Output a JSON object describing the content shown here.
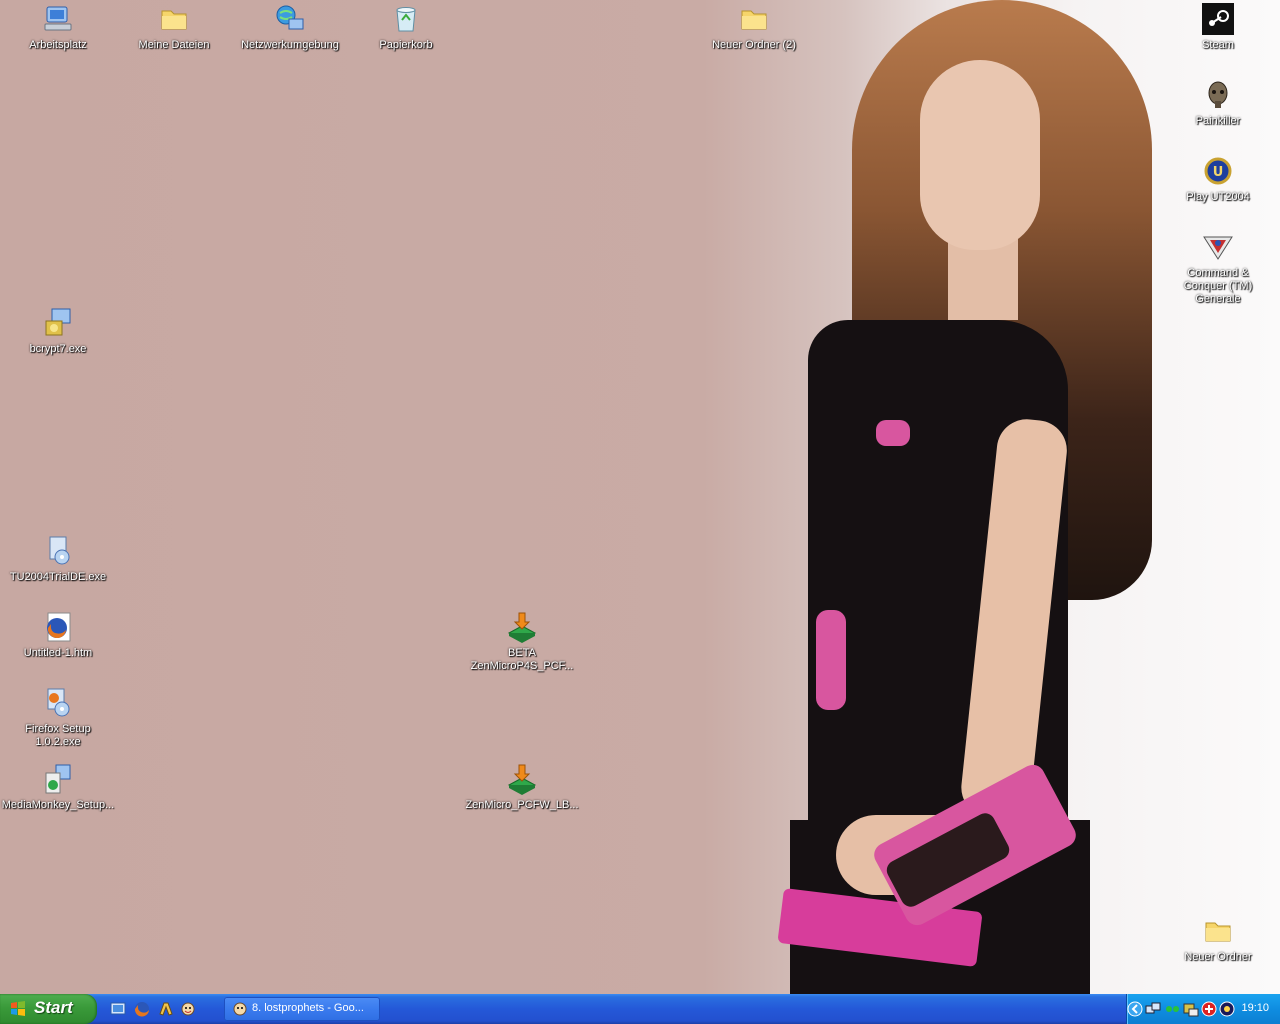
{
  "desktop": {
    "icons": [
      {
        "label": "Arbeitsplatz",
        "icon": "my-computer-icon"
      },
      {
        "label": "Meine Dateien",
        "icon": "folder-icon"
      },
      {
        "label": "Netzwerkumgebung",
        "icon": "network-places-icon"
      },
      {
        "label": "Papierkorb",
        "icon": "recycle-bin-icon"
      },
      {
        "label": "Neuer Ordner (2)",
        "icon": "folder-icon"
      },
      {
        "label": "Steam",
        "icon": "steam-icon"
      },
      {
        "label": "Painkiller",
        "icon": "painkiller-icon"
      },
      {
        "label": "Play UT2004",
        "icon": "ut2004-icon"
      },
      {
        "label": "Command &\nConquer (TM) Generale",
        "icon": "command-conquer-icon"
      },
      {
        "label": "bcrypt7.exe",
        "icon": "installer-icon"
      },
      {
        "label": "TU2004TrialDE.exe",
        "icon": "setup-icon"
      },
      {
        "label": "Untitled-1.htm",
        "icon": "firefox-document-icon"
      },
      {
        "label": "BETA\nZenMicroP4S_PCF...",
        "icon": "download-icon"
      },
      {
        "label": "Firefox Setup\n1.0.2.exe",
        "icon": "setup-icon"
      },
      {
        "label": "MediaMonkey_Setup...",
        "icon": "mediamonkey-setup-icon"
      },
      {
        "label": "ZenMicro_PCFW_LB...",
        "icon": "download-icon"
      },
      {
        "label": "Neuer Ordner",
        "icon": "folder-icon"
      }
    ]
  },
  "taskbar": {
    "start_label": "Start",
    "quick_launch": [
      "show-desktop-icon",
      "firefox-icon",
      "winamp-icon",
      "gaim-icon"
    ],
    "task_button": {
      "label": "8. lostprophets - Goo...",
      "icon": "winamp-icon"
    },
    "tray_icons": [
      "chevron-left-icon",
      "network-icon",
      "status-icon",
      "volume-icon",
      "antivirus-icon",
      "speaker-icon"
    ],
    "clock": "19:10"
  },
  "colors": {
    "wallpaper": "#c7a8a2",
    "taskbar": "#2458d8",
    "start_button": "#3a9a3a",
    "tray": "#0f8de1"
  }
}
